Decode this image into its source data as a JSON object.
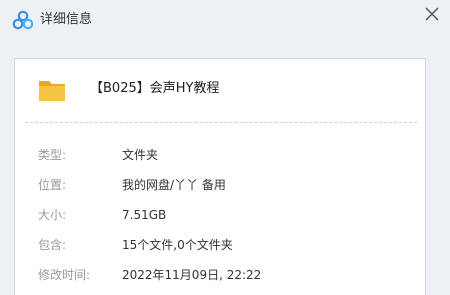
{
  "window": {
    "title": "详细信息",
    "logo_icon": "baidu-netdisk-logo-icon",
    "close_icon": "close-icon"
  },
  "file": {
    "icon": "folder-icon",
    "name": "【B025】会声HY教程"
  },
  "details": [
    {
      "label": "类型:",
      "value": "文件夹"
    },
    {
      "label": "位置:",
      "value": "我的网盘/丫丫 备用"
    },
    {
      "label": "大小:",
      "value": "7.51GB"
    },
    {
      "label": "包含:",
      "value": "15个文件,0个文件夹"
    },
    {
      "label": "修改时间:",
      "value": "2022年11月09日, 22:22"
    }
  ],
  "colors": {
    "background": "#eef1f4",
    "panel": "#ffffff",
    "folder": "#f6c343",
    "logo_blue": "#3a8ee6",
    "divider": "#b7dcd8"
  }
}
